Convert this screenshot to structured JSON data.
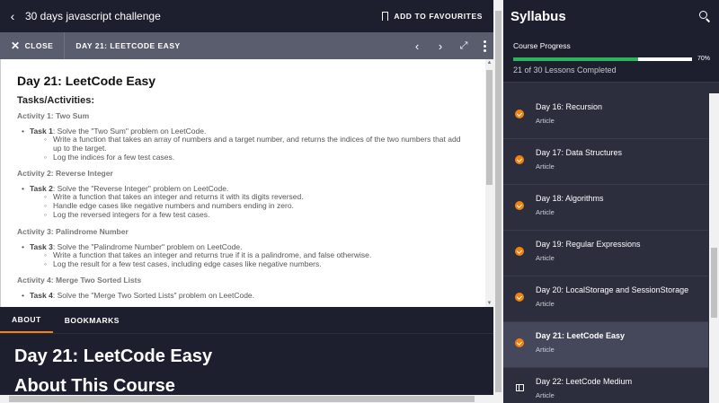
{
  "header": {
    "back_glyph": "‹",
    "course_title": "30 days javascript challenge",
    "favourites_label": "ADD TO FAVOURITES"
  },
  "lesson_bar": {
    "close_label": "CLOSE",
    "lesson_name": "DAY 21: LEETCODE EASY"
  },
  "content": {
    "title": "Day 21: LeetCode Easy",
    "subtitle": "Tasks/Activities:",
    "activities": [
      {
        "heading": "Activity 1: Two Sum",
        "task_label": "Task 1",
        "task_text": ": Solve the \"Two Sum\" problem on LeetCode.",
        "subs": [
          "Write a function that takes an array of numbers and a target number, and returns the indices of the two numbers that add up to the target.",
          "Log the indices for a few test cases."
        ]
      },
      {
        "heading": "Activity 2: Reverse Integer",
        "task_label": "Task 2",
        "task_text": ": Solve the \"Reverse Integer\" problem on LeetCode.",
        "subs": [
          "Write a function that takes an integer and returns it with its digits reversed.",
          "Handle edge cases like negative numbers and numbers ending in zero.",
          "Log the reversed integers for a few test cases."
        ]
      },
      {
        "heading": "Activity 3: Palindrome Number",
        "task_label": "Task 3",
        "task_text": ": Solve the \"Palindrome Number\" problem on LeetCode.",
        "subs": [
          "Write a function that takes an integer and returns true if it is a palindrome, and false otherwise.",
          "Log the result for a few test cases, including edge cases like negative numbers."
        ]
      },
      {
        "heading": "Activity 4: Merge Two Sorted Lists",
        "task_label": "Task 4",
        "task_text": ": Solve the \"Merge Two Sorted Lists\" problem on LeetCode.",
        "subs": []
      }
    ]
  },
  "tabs": {
    "about": "ABOUT",
    "bookmarks": "BOOKMARKS"
  },
  "about": {
    "title": "Day 21: LeetCode Easy",
    "section": "About This Course"
  },
  "sidebar": {
    "title": "Syllabus",
    "progress_label": "Course Progress",
    "progress_fraction": 0.7,
    "progress_pct": "70%",
    "lessons_completed": "21 of 30 Lessons Completed",
    "lessons": [
      {
        "name": "Day 16: Recursion",
        "kind": "Article",
        "status": "completed",
        "icon": "check-icon"
      },
      {
        "name": "Day 17: Data Structures",
        "kind": "Article",
        "status": "completed",
        "icon": "check-icon"
      },
      {
        "name": "Day 18: Algorithms",
        "kind": "Article",
        "status": "completed",
        "icon": "check-icon"
      },
      {
        "name": "Day 19: Regular Expressions",
        "kind": "Article",
        "status": "completed",
        "icon": "check-icon"
      },
      {
        "name": "Day 20: LocalStorage and SessionStorage",
        "kind": "Article",
        "status": "completed",
        "icon": "check-icon"
      },
      {
        "name": "Day 21: LeetCode Easy",
        "kind": "Article",
        "status": "current",
        "icon": "check-icon"
      },
      {
        "name": "Day 22: LeetCode Medium",
        "kind": "Article",
        "status": "locked",
        "icon": "book-icon"
      }
    ]
  },
  "colors": {
    "accent": "#f2820d",
    "progress": "#2db45a",
    "header_bg": "#1e1f2e",
    "sidebar_bg": "#2c2d3d",
    "toolbar_bg": "#5a5d6e"
  }
}
